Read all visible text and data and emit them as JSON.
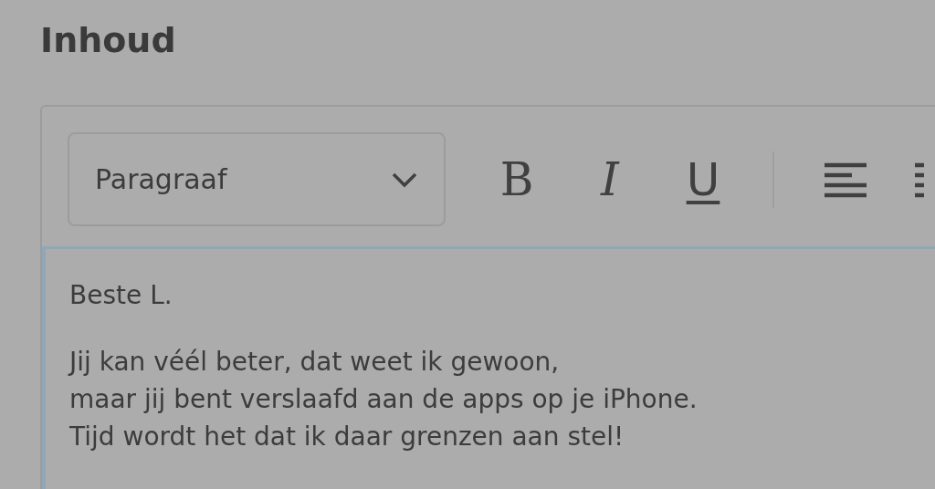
{
  "section_title": "Inhoud",
  "toolbar": {
    "block_format": "Paragraaf",
    "buttons": [
      {
        "kind": "bold",
        "label": "B"
      },
      {
        "kind": "italic",
        "label": "I"
      },
      {
        "kind": "underline",
        "label": "U"
      },
      {
        "kind": "divider"
      },
      {
        "kind": "align-left"
      },
      {
        "kind": "more"
      }
    ]
  },
  "editor": {
    "paragraphs": [
      {
        "lines": [
          "Beste L."
        ]
      },
      {
        "lines": [
          "Jij kan véél beter, dat weet ik gewoon,",
          "maar jij bent verslaafd aan de apps op je iPhone.",
          "Tijd wordt het dat ik daar grenzen aan stel!"
        ]
      }
    ]
  }
}
